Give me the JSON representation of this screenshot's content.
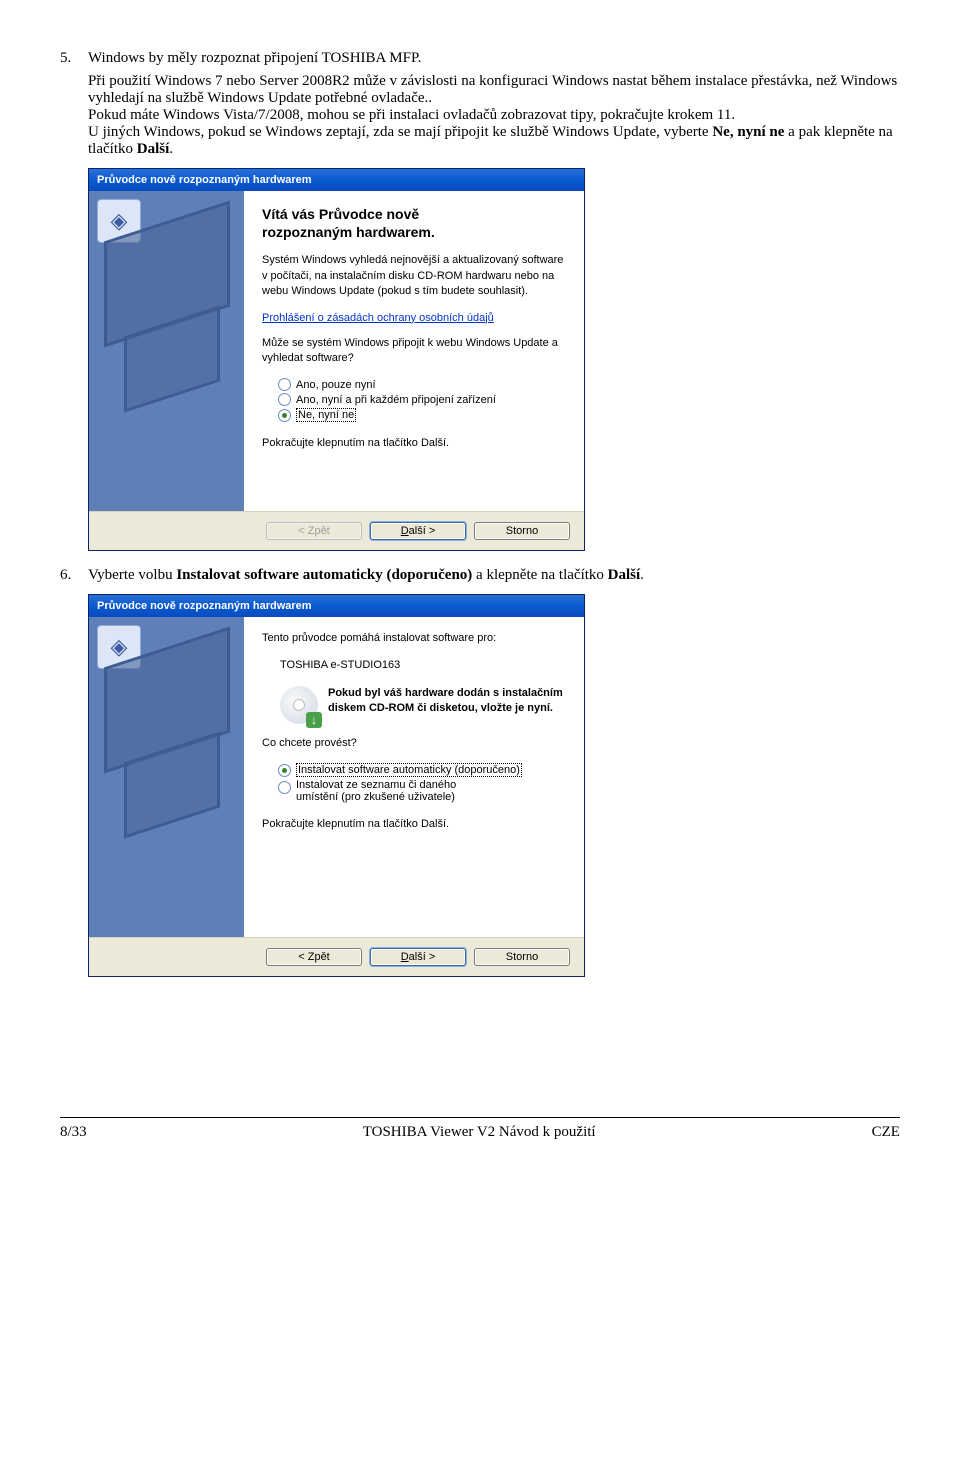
{
  "doc": {
    "step5_num": "5.",
    "step5_text": "Windows by měly rozpoznat připojení TOSHIBA MFP.",
    "step5_p2a": "Při použití Windows 7 nebo Server 2008R2 může v závislosti na konfiguraci Windows nastat během instalace přestávka, než Windows vyhledají na službě Windows Update potřebné ovladače..",
    "step5_p2b": "Pokud máte Windows Vista/7/2008, mohou se při instalaci ovladačů zobrazovat tipy, pokračujte krokem 11.",
    "step5_p2c_a": "U jiných Windows, pokud se Windows zeptají, zda se mají připojit ke službě Windows Update, vyberte ",
    "step5_p2c_bold": "Ne, nyní ne",
    "step5_p2c_b": " a pak klepněte na tlačítko ",
    "step5_p2c_bold2": "Další",
    "step5_p2c_end": ".",
    "step6_num": "6.",
    "step6_a": "Vyberte volbu ",
    "step6_bold": "Instalovat software automaticky (doporučeno)",
    "step6_b": " a klepněte na tlačítko ",
    "step6_bold2": "Další",
    "step6_end": "."
  },
  "dlg1": {
    "title": "Průvodce nově rozpoznaným hardwarem",
    "h1_l1": "Vítá vás Průvodce nově",
    "h1_l2": "rozpoznaným hardwarem.",
    "p1": "Systém Windows vyhledá nejnovější a aktualizovaný software v počítači, na instalačním disku CD-ROM hardwaru nebo na webu Windows Update (pokud s tím budete souhlasit).",
    "link": "Prohlášení o zásadách ochrany osobních údajů",
    "p2": "Může se systém Windows připojit k webu Windows Update a vyhledat software?",
    "opt1": "Ano, pouze nyní",
    "opt2": "Ano, nyní a při každém připojení zařízení",
    "opt3": "Ne, nyní ne",
    "continue": "Pokračujte klepnutím na tlačítko Další.",
    "btn_back": "< Zpět",
    "btn_next_prefix": "D",
    "btn_next_rest": "alší >",
    "btn_cancel": "Storno"
  },
  "dlg2": {
    "title": "Průvodce nově rozpoznaným hardwarem",
    "p1": "Tento průvodce pomáhá instalovat software pro:",
    "device": "TOSHIBA e-STUDIO163",
    "hw_l1": "Pokud byl váš hardware dodán s instalačním",
    "hw_l2": "diskem CD-ROM či disketou, vložte je nyní.",
    "q": "Co chcete provést?",
    "opt1": "Instalovat software automaticky (doporučeno)",
    "opt2a": "Instalovat ze seznamu či daného",
    "opt2b": "umístění (pro zkušené uživatele)",
    "continue": "Pokračujte klepnutím na tlačítko Další.",
    "btn_back": "< Zpět",
    "btn_next_prefix": "D",
    "btn_next_rest": "alší >",
    "btn_cancel": "Storno"
  },
  "footer": {
    "left": "8/33",
    "center": "TOSHIBA Viewer V2 Návod k použití",
    "right": "CZE"
  }
}
